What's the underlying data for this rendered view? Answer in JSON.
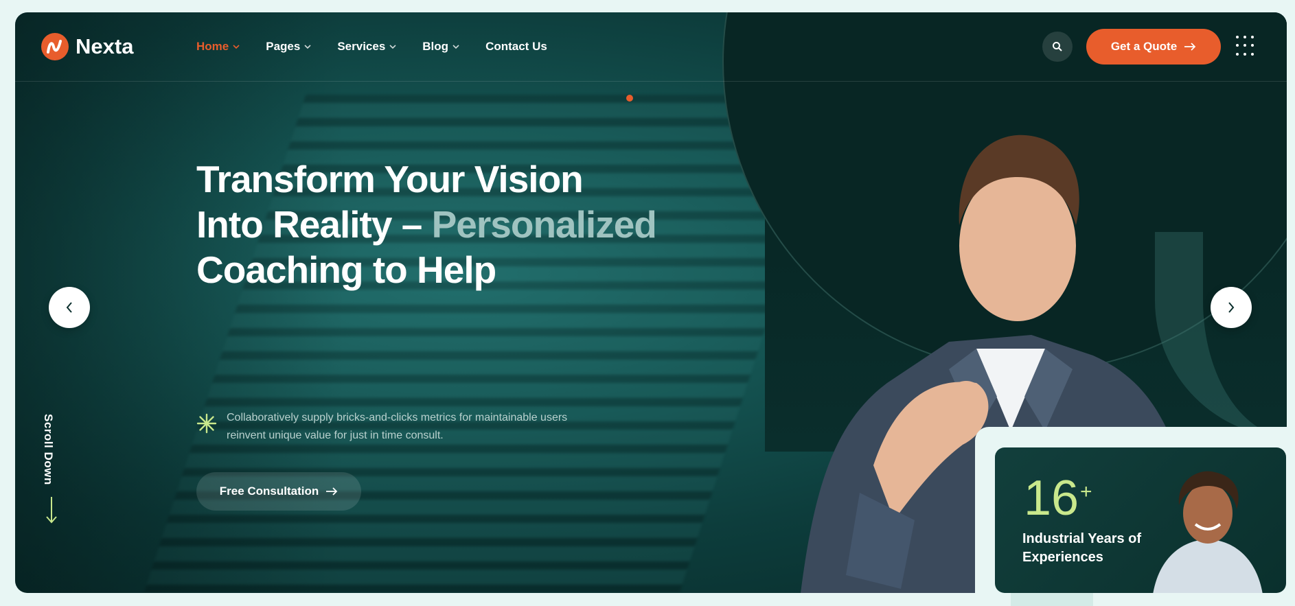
{
  "brand": {
    "name": "Nexta",
    "accent": "#e85d2c"
  },
  "nav": {
    "items": [
      {
        "label": "Home",
        "has_dropdown": true,
        "active": true
      },
      {
        "label": "Pages",
        "has_dropdown": true,
        "active": false
      },
      {
        "label": "Services",
        "has_dropdown": true,
        "active": false
      },
      {
        "label": "Blog",
        "has_dropdown": true,
        "active": false
      },
      {
        "label": "Contact Us",
        "has_dropdown": false,
        "active": false
      }
    ]
  },
  "header": {
    "search_icon": "search-icon",
    "quote_label": "Get a Quote",
    "menu_icon": "grid-menu-icon"
  },
  "hero": {
    "headline_line1": "Transform Your Vision",
    "headline_line2_a": "Into Reality –",
    "headline_line2_b": "Personalized",
    "headline_line3": "Coaching to Help",
    "description": "Collaboratively supply bricks-and-clicks metrics for maintainable users reinvent unique value for just in time consult.",
    "cta_label": "Free Consultation",
    "scroll_label": "Scroll Down"
  },
  "stats": {
    "number": "16",
    "suffix": "+",
    "label": "Industrial Years of Experiences"
  },
  "colors": {
    "accent": "#e85d2c",
    "highlight": "#c9e88c",
    "muted_headline": "#9fc3c0"
  }
}
